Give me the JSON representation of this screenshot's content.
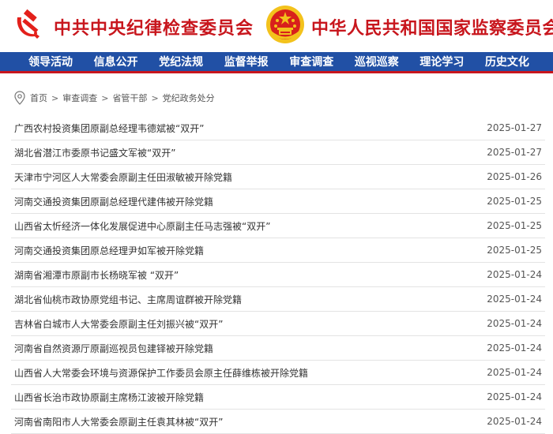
{
  "header": {
    "left_title": "中共中央纪律检查委员会",
    "right_title": "中华人民共和国国家监察委员会"
  },
  "nav": {
    "items": [
      "领导活动",
      "信息公开",
      "党纪法规",
      "监督举报",
      "审查调查",
      "巡视巡察",
      "理论学习",
      "历史文化"
    ]
  },
  "breadcrumb": {
    "items": [
      "首页",
      "审查调查",
      "省管干部",
      "党纪政务处分"
    ],
    "separator": ">"
  },
  "articles": [
    {
      "title": "广西农村投资集团原副总经理韦德斌被“双开”",
      "date": "2025-01-27"
    },
    {
      "title": "湖北省潜江市委原书记盛文军被“双开”",
      "date": "2025-01-27"
    },
    {
      "title": "天津市宁河区人大常委会原副主任田淑敏被开除党籍",
      "date": "2025-01-26"
    },
    {
      "title": "河南交通投资集团原副总经理代建伟被开除党籍",
      "date": "2025-01-25"
    },
    {
      "title": "山西省太忻经济一体化发展促进中心原副主任马志强被“双开”",
      "date": "2025-01-25"
    },
    {
      "title": "河南交通投资集团原总经理尹如军被开除党籍",
      "date": "2025-01-25"
    },
    {
      "title": "湖南省湘潭市原副市长杨晓军被 “双开”",
      "date": "2025-01-24"
    },
    {
      "title": "湖北省仙桃市政协原党组书记、主席周谊群被开除党籍",
      "date": "2025-01-24"
    },
    {
      "title": "吉林省白城市人大常委会原副主任刘振兴被“双开”",
      "date": "2025-01-24"
    },
    {
      "title": "河南省自然资源厅原副巡视员包建铎被开除党籍",
      "date": "2025-01-24"
    },
    {
      "title": "山西省人大常委会环境与资源保护工作委员会原主任薛维栋被开除党籍",
      "date": "2025-01-24"
    },
    {
      "title": "山西省长治市政协原副主席杨江波被开除党籍",
      "date": "2025-01-24"
    },
    {
      "title": "河南省南阳市人大常委会原副主任袁其林被“双开”",
      "date": "2025-01-24"
    }
  ],
  "colors": {
    "brand_red": "#c8161d",
    "nav_blue": "#2150a5",
    "gold": "#f3c21c"
  },
  "icons": [
    "party-emblem-icon",
    "national-emblem-icon",
    "location-pin-icon"
  ]
}
